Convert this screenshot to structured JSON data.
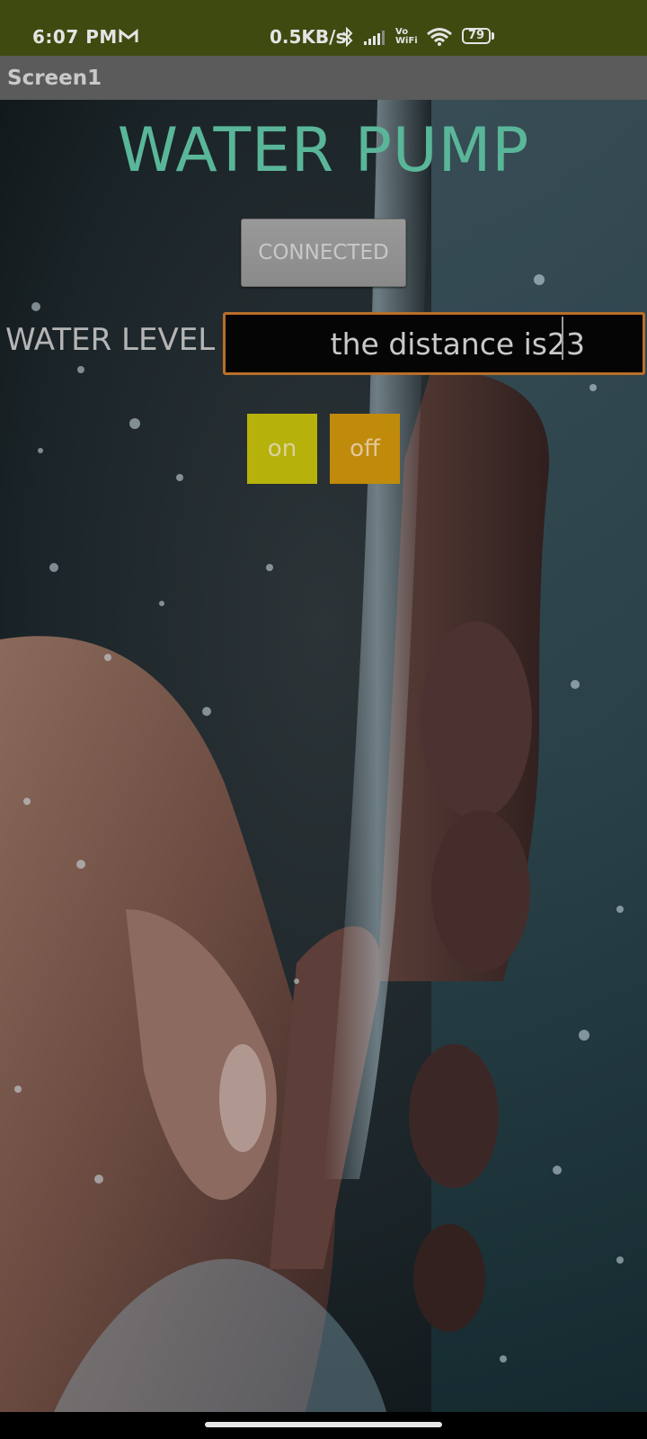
{
  "status_bar": {
    "time": "6:07 PM",
    "net_speed": "0.5KB/s",
    "vowifi": "Vo\nWiFi",
    "battery": "79",
    "icons": [
      "gmail-icon",
      "bluetooth-icon",
      "signal-icon",
      "wifi-icon",
      "battery-icon"
    ]
  },
  "app_bar": {
    "title": "Screen1"
  },
  "main": {
    "title": "WATER PUMP",
    "connect_button": "CONNECTED",
    "water_level_label": "WATER LEVEL",
    "water_level_value": "the distance is23",
    "on_button": "on",
    "off_button": "off"
  },
  "colors": {
    "status_bar_bg": "#3f4a10",
    "app_bar_bg": "#5b5b5b",
    "title_color": "#5ab699",
    "on_button_bg": "#b7b10b",
    "off_button_bg": "#c08a0b",
    "field_border": "#b86f28"
  }
}
